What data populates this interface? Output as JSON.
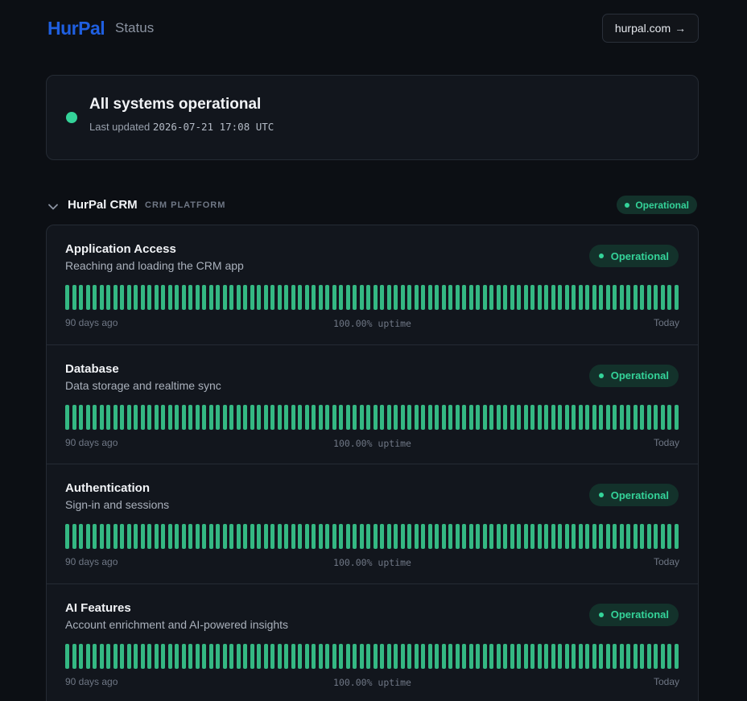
{
  "header": {
    "logo": "HurPal",
    "subtitle": "Status",
    "site_link": "hurpal.com",
    "site_link_arrow": "→"
  },
  "summary": {
    "title": "All systems operational",
    "updated_label": "Last updated",
    "updated_time": "2026-07-21 17:08 UTC",
    "status_color": "#34d399"
  },
  "group": {
    "name": "HurPal CRM",
    "subtitle": "CRM PLATFORM",
    "status": "Operational",
    "expand_icon": "chevron-down-icon"
  },
  "bar_count": 90,
  "colors": {
    "operational": "#34b883",
    "accent": "#1f5fe0"
  },
  "components": [
    {
      "name": "Application Access",
      "description": "Reaching and loading the CRM app",
      "status": "Operational",
      "uptime": "100.00% uptime",
      "start_label": "90 days ago",
      "end_label": "Today"
    },
    {
      "name": "Database",
      "description": "Data storage and realtime sync",
      "status": "Operational",
      "uptime": "100.00% uptime",
      "start_label": "90 days ago",
      "end_label": "Today"
    },
    {
      "name": "Authentication",
      "description": "Sign-in and sessions",
      "status": "Operational",
      "uptime": "100.00% uptime",
      "start_label": "90 days ago",
      "end_label": "Today"
    },
    {
      "name": "AI Features",
      "description": "Account enrichment and AI-powered insights",
      "status": "Operational",
      "uptime": "100.00% uptime",
      "start_label": "90 days ago",
      "end_label": "Today"
    }
  ]
}
